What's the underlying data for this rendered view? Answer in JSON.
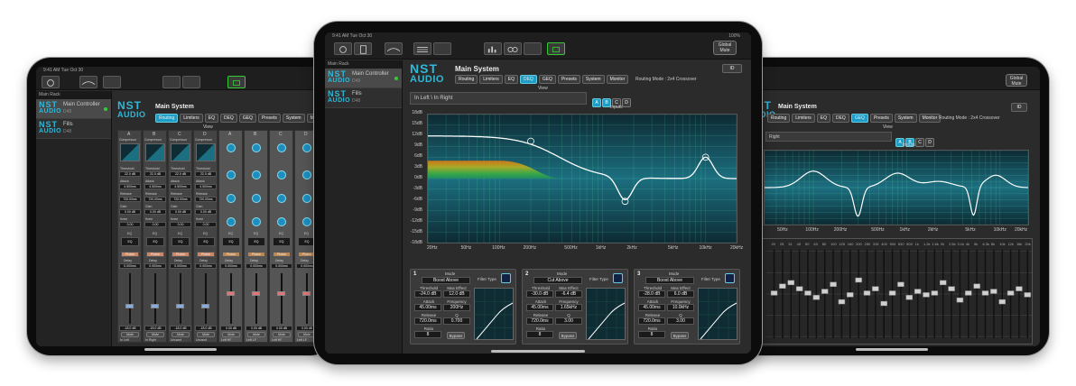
{
  "status_left": "9:41 AM  Tue Oct 30",
  "status_right": "100%",
  "toolbar": {
    "global_mute": "Global Mute",
    "icons": [
      "settings-icon",
      "document-icon",
      "curve-icon",
      "lines-icon",
      "meter-icon",
      "tape-icon",
      "chart-icon",
      "link-icon",
      "network-icon"
    ]
  },
  "sidebar": {
    "header": "Main Rack",
    "units": [
      {
        "logo_top": "NST",
        "logo_bottom": "AUDIO",
        "name": "Main Controller",
        "model": "D48",
        "selected": true
      },
      {
        "logo_top": "NST",
        "logo_bottom": "AUDIO",
        "name": "Fills",
        "model": "D48",
        "selected": false
      }
    ]
  },
  "system": {
    "title": "Main System",
    "id_label": "ID",
    "tabs": [
      "Routing",
      "Limiters",
      "EQ",
      "DEQ",
      "GEQ",
      "Presets",
      "System",
      "Monitor"
    ],
    "routing_mode": "Routing Mode : 2x4 Crossover",
    "view_label": "View",
    "channel": "In Left \\ In Right",
    "channel_short": "Right",
    "inputs_label": "Inputs",
    "inputs": [
      "A",
      "B",
      "C",
      "D"
    ]
  },
  "graph": {
    "y_labels": [
      "18dB",
      "15dB",
      "12dB",
      "9dB",
      "6dB",
      "3dB",
      "0dB",
      "-3dB",
      "-6dB",
      "-9dB",
      "-12dB",
      "-15dB",
      "-18dB"
    ],
    "x_labels": [
      "20Hz",
      "50Hz",
      "100Hz",
      "200Hz",
      "500Hz",
      "1kHz",
      "2kHz",
      "5kHz",
      "10kHz",
      "20kHz"
    ],
    "right_x_labels": [
      "50Hz",
      "100Hz",
      "200Hz",
      "500Hz",
      "1kHz",
      "2kHz",
      "5kHz",
      "10kHz",
      "20kHz"
    ]
  },
  "bands": [
    {
      "num": "1",
      "mode_label": "Mode",
      "mode": "Boost Above",
      "filter_label": "Filter Type",
      "threshold_label": "Threshold",
      "threshold": "-24.0 dB",
      "max_label": "Max Effect",
      "max": "12.0 dB",
      "attack_label": "Attack",
      "attack": "45.00ms",
      "freq_label": "Frequency",
      "freq": "200Hz",
      "release_label": "Release",
      "release": "720.0ms",
      "q_label": "Q",
      "q": "0.700",
      "ratio_label": "Ratio",
      "ratio": "8",
      "bypass": "Bypass"
    },
    {
      "num": "2",
      "mode_label": "Mode",
      "mode": "Cut Above",
      "filter_label": "Filter Type",
      "threshold_label": "Threshold",
      "threshold": "-30.0 dB",
      "max_label": "Max Effect",
      "max": "-6.4 dB",
      "attack_label": "Attack",
      "attack": "45.00ms",
      "freq_label": "Frequency",
      "freq": "1.65kHz",
      "release_label": "Release",
      "release": "720.0ms",
      "q_label": "Q",
      "q": "3.00",
      "ratio_label": "Ratio",
      "ratio": "8",
      "bypass": "Bypass"
    },
    {
      "num": "3",
      "mode_label": "Mode",
      "mode": "Boost Above",
      "filter_label": "Filter Type",
      "threshold_label": "Threshold",
      "threshold": "-28.0 dB",
      "max_label": "Max Effect",
      "max": "6.0 dB",
      "attack_label": "Attack",
      "attack": "45.00ms",
      "freq_label": "Frequency",
      "freq": "10.0kHz",
      "release_label": "Release",
      "release": "720.0ms",
      "q_label": "Q",
      "q": "3.00",
      "ratio_label": "Ratio",
      "ratio": "8",
      "bypass": "Bypass"
    }
  ],
  "mixer": {
    "strips_a": [
      "A",
      "B",
      "C",
      "D"
    ],
    "compressor_label": "Compressor",
    "threshold_label": "Threshold",
    "threshold": "22.0 dB",
    "attack_label": "Attack",
    "attack": "4.500ms",
    "release_label": "Release",
    "release": "720.00ms",
    "gain_label": "Gain",
    "gain": "0.00 dB",
    "knee_label": "Knee",
    "knee": "0.00",
    "eq_label": "EQ",
    "polarity_label": "Phase",
    "delay_label": "Delay",
    "delay": "0.000ms",
    "level": "-18.0 dB",
    "level2": "0.00 dB",
    "mute": "Mute",
    "in_labels": [
      "In Left",
      "In Right",
      "Unused",
      "Unused"
    ],
    "out_labels": [
      "Left HF",
      "Left LF",
      "Left HF",
      "Left LF"
    ],
    "fader_scale": [
      "12",
      "6",
      "0",
      "-6",
      "-12",
      "-18",
      "-24",
      "-36",
      "-48",
      "-60"
    ]
  },
  "geq": {
    "freqs": [
      "20",
      "25",
      "31",
      "40",
      "50",
      "63",
      "80",
      "100",
      "125",
      "160",
      "200",
      "250",
      "315",
      "400",
      "500",
      "630",
      "800",
      "1k",
      "1.2k",
      "1.6k",
      "2k",
      "2.5k",
      "3.1k",
      "4k",
      "5k",
      "6.3k",
      "8k",
      "10k",
      "12k",
      "16k",
      "20k"
    ],
    "scale": [
      "12",
      "6",
      "0",
      "-6",
      "-12"
    ]
  }
}
